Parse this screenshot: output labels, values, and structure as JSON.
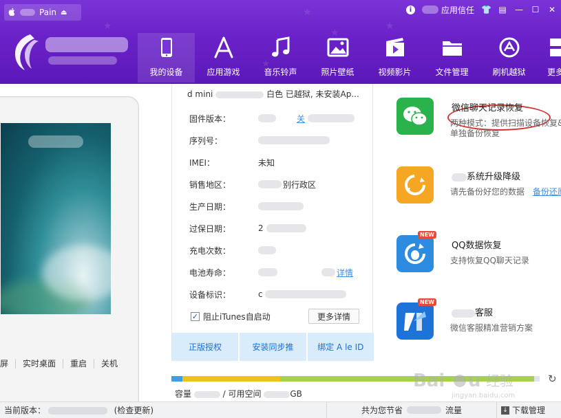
{
  "titlebar": {
    "device_tab_label": "Pa",
    "device_tab_suffix": "in",
    "app_trust": "应用信任"
  },
  "nav": [
    {
      "label": "我的设备",
      "icon": "tablet-icon",
      "active": true
    },
    {
      "label": "应用游戏",
      "icon": "app-store-icon"
    },
    {
      "label": "音乐铃声",
      "icon": "music-note-icon"
    },
    {
      "label": "照片壁纸",
      "icon": "photo-icon"
    },
    {
      "label": "视频影片",
      "icon": "video-icon"
    },
    {
      "label": "文件管理",
      "icon": "folder-icon"
    },
    {
      "label": "刷机越狱",
      "icon": "flash-icon"
    },
    {
      "label": "更多",
      "icon": "more-icon"
    }
  ],
  "device_actions": [
    "屏",
    "实时桌面",
    "重启",
    "关机"
  ],
  "device_info": {
    "model_line": "d mini",
    "model_tail": "白色 已越狱, 未安装Ap...",
    "rows": [
      {
        "label": "固件版本：",
        "value": "",
        "link": "关"
      },
      {
        "label": "序列号：",
        "value": ""
      },
      {
        "label": "IMEI：",
        "value": "未知"
      },
      {
        "label": "销售地区：",
        "value": "别行政区"
      },
      {
        "label": "生产日期：",
        "value": ""
      },
      {
        "label": "过保日期：",
        "value": "2"
      },
      {
        "label": "充电次数：",
        "value": ""
      },
      {
        "label": "电池寿命：",
        "value": "",
        "link": "详情"
      },
      {
        "label": "设备标识：",
        "value": "c"
      }
    ],
    "checkbox_label": "阻止iTunes自启动",
    "checkbox_checked": true,
    "more_details": "更多详情",
    "bottom_buttons": [
      "正版授权",
      "安装同步推",
      "绑定 A    le ID"
    ]
  },
  "tools": [
    {
      "title": "微信聊天记录恢复",
      "desc_line1": "两种模式：提供扫描设备恢复&",
      "desc_line2": "单独备份恢复",
      "icon": "wechat-icon",
      "color": "#2ab34a"
    },
    {
      "title": "系统升级降级",
      "desc_line1": "请先备份好您的数据",
      "link": "备份还原",
      "icon": "upgrade-icon",
      "color": "#f5a623"
    },
    {
      "title": "QQ数据恢复",
      "desc_line1": "支持恢复QQ聊天记录",
      "icon": "qq-recover-icon",
      "color": "#2d8be0",
      "badge": "NEW"
    },
    {
      "title": "客服",
      "desc_line1": "微信客服精准营销方案",
      "icon": "customer-service-icon",
      "color": "#1e73d8",
      "badge": "NEW"
    }
  ],
  "storage": {
    "label": "容量",
    "sep": "/ 可用空间",
    "unit": "GB",
    "used_fraction": 0.31,
    "colors": {
      "media": "#3aa0e0",
      "apps": "#f0c020",
      "other": "#a8d050"
    }
  },
  "status": {
    "current_version": "当前版本：",
    "check_update": "(检查更新)",
    "save_label": "共为您节省",
    "save_unit": "流量",
    "download_mgmt": "下载管理"
  },
  "colors": {
    "header": "#6a22c8",
    "accent": "#3a8ee6"
  }
}
